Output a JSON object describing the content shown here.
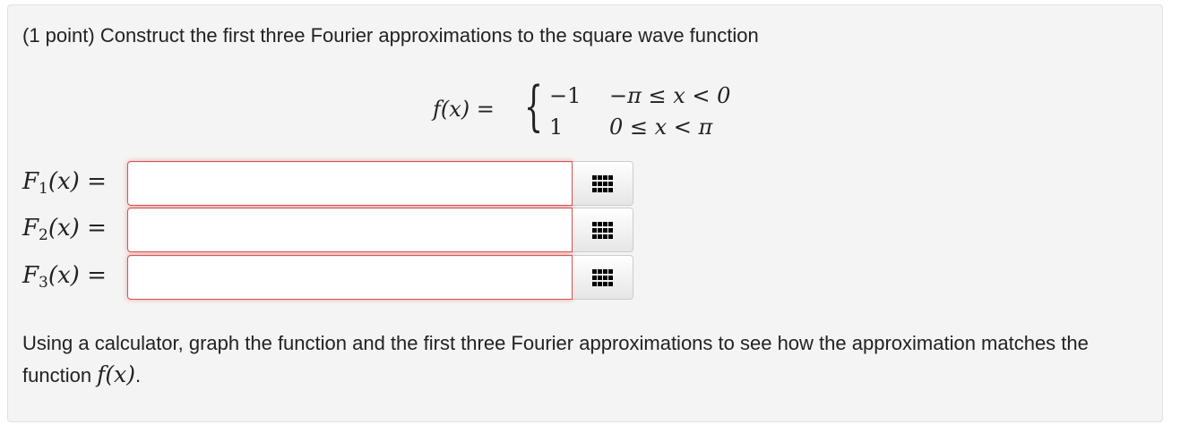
{
  "problem": {
    "intro": "(1 point) Construct the first three Fourier approximations to the square wave function",
    "equation": {
      "lhs": "f(x) =",
      "cases": [
        {
          "value": "−1",
          "condition": "−π ≤ x < 0"
        },
        {
          "value": "1",
          "condition": "0 ≤ x < π"
        }
      ]
    },
    "answers": [
      {
        "label": "F",
        "sub": "1",
        "arg": "(x) =",
        "value": ""
      },
      {
        "label": "F",
        "sub": "2",
        "arg": "(x) =",
        "value": ""
      },
      {
        "label": "F",
        "sub": "3",
        "arg": "(x) =",
        "value": ""
      }
    ],
    "palette_icon": "grid-icon",
    "outro_text": "Using a calculator, graph the function and the first three Fourier approximations to see how the approximation matches the function ",
    "outro_math": "f(x)",
    "outro_end": ".",
    "colors": {
      "panel_bg": "#f4f4f4",
      "error_border": "#d9534f"
    }
  }
}
